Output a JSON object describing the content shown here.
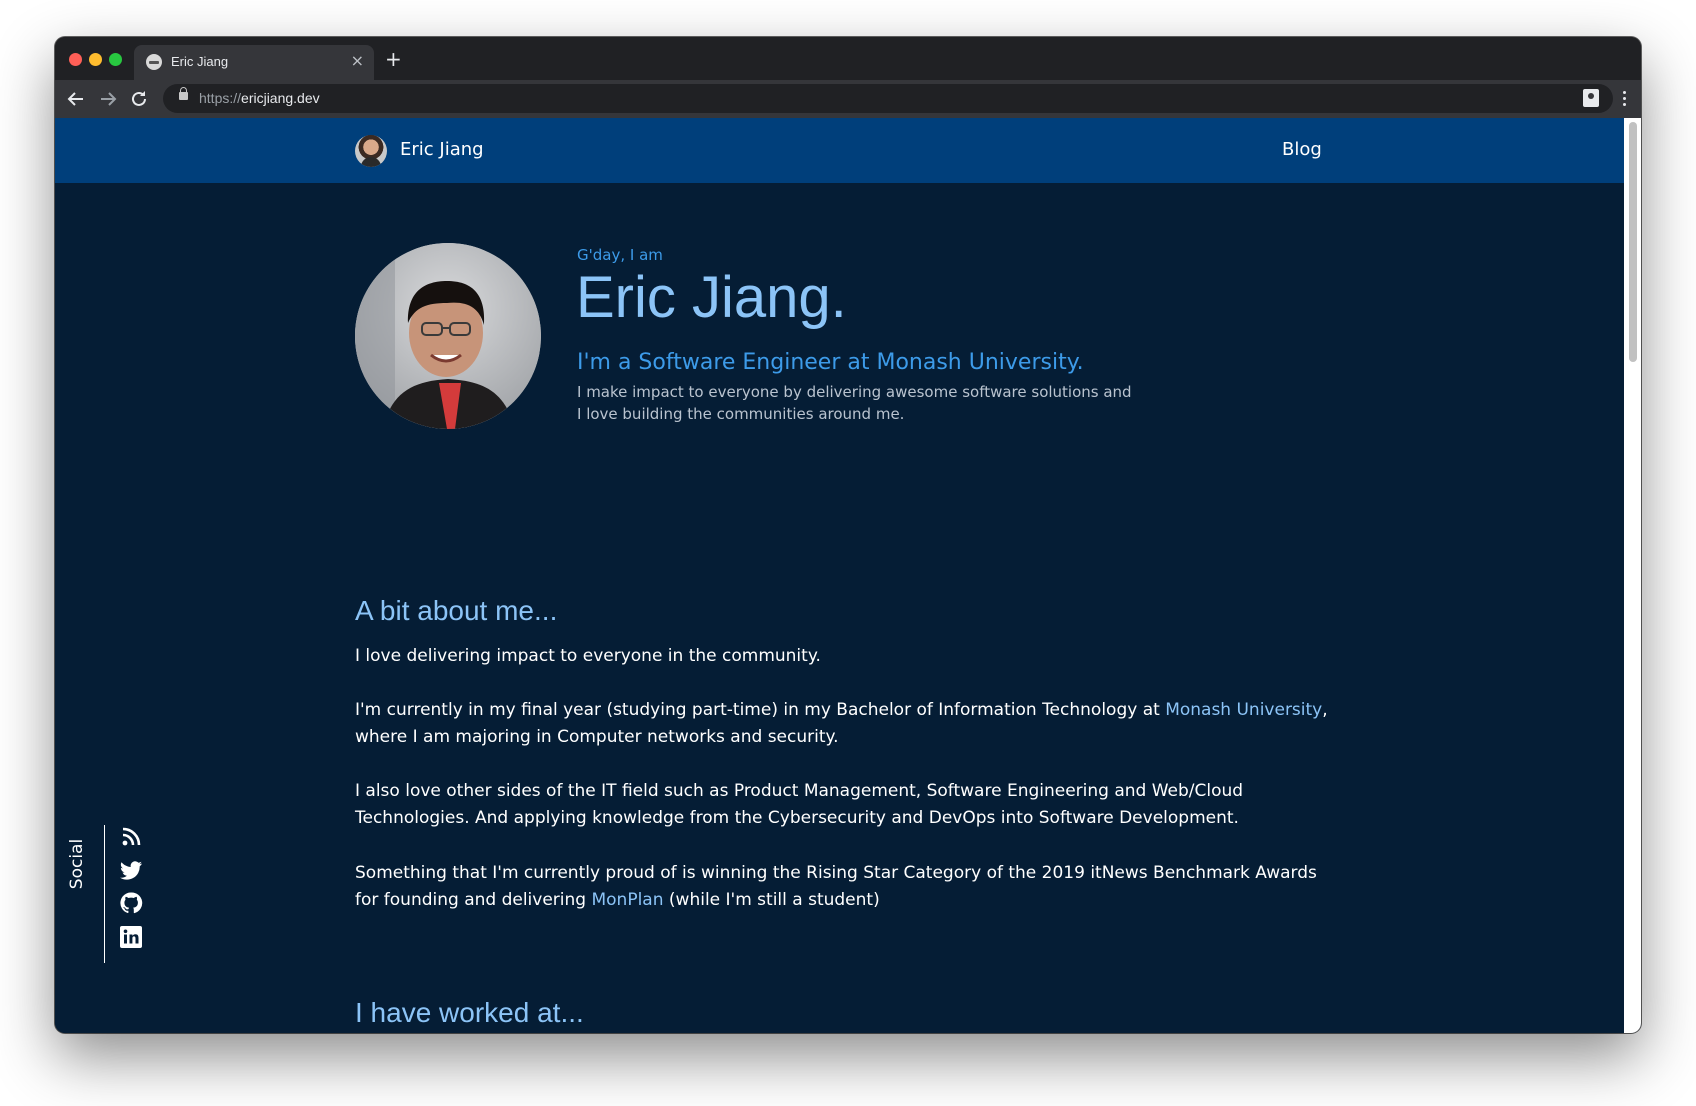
{
  "browser": {
    "tab_title": "Eric Jiang",
    "tab_close": "×",
    "new_tab": "+",
    "url_scheme": "https://",
    "url_host": "ericjiang.dev"
  },
  "header": {
    "name": "Eric Jiang",
    "blog_link": "Blog"
  },
  "hero": {
    "greeting": "G'day, I am",
    "name": "Eric Jiang.",
    "role": "I'm a Software Engineer at Monash University.",
    "description": "I make impact to everyone by delivering awesome software solutions and I love building the communities around me."
  },
  "about": {
    "title": "A bit about me...",
    "p1": "I love delivering impact to everyone in the community.",
    "p2_before": "I'm currently in my final year (studying part-time) in my Bachelor of Information Technology at ",
    "p2_link": "Monash University",
    "p2_after": ", where I am majoring in Computer networks and security.",
    "p3": "I also love other sides of the IT field such as Product Management, Software Engineering and Web/Cloud Technologies. And applying knowledge from the Cybersecurity and DevOps into Software Development.",
    "p4_before": "Something that I'm currently proud of is winning the Rising Star Category of the 2019 itNews Benchmark Awards for founding and delivering ",
    "p4_link": "MonPlan",
    "p4_after": " (while I'm still a student)"
  },
  "worked": {
    "title": "I have worked at..."
  },
  "social": {
    "label": "Social",
    "icons": [
      "rss-icon",
      "twitter-icon",
      "github-icon",
      "linkedin-icon"
    ]
  },
  "colors": {
    "page_bg": "#051d35",
    "header_bg": "#003f7b",
    "accent": "#3d9be9",
    "heading": "#8cc4f7"
  }
}
